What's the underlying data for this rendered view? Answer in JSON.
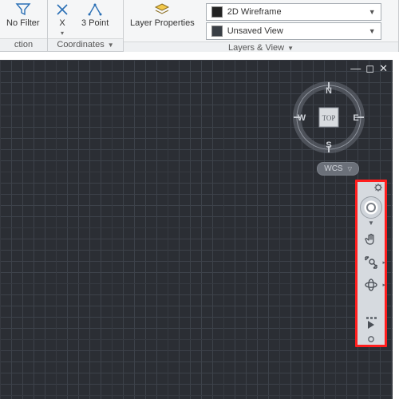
{
  "ribbon": {
    "groups": {
      "selection": {
        "title": "ction",
        "nofilter_label": "No Filter"
      },
      "coordinates": {
        "title": "Coordinates",
        "x_label": "X",
        "threepoint_label": "3 Point"
      },
      "layers": {
        "title": "Layers & View",
        "layerprops_label": "Layer Properties",
        "dd_wireframe": "2D Wireframe",
        "dd_view": "Unsaved View"
      }
    }
  },
  "viewcube": {
    "face": "TOP",
    "n": "N",
    "s": "S",
    "e": "E",
    "w": "W",
    "wcs_label": "WCS"
  },
  "navbar": {
    "tools": [
      "steering-wheel",
      "pan",
      "zoom-extents",
      "orbit",
      "showmotion"
    ]
  },
  "colors": {
    "highlight": "#ff1e1e"
  }
}
